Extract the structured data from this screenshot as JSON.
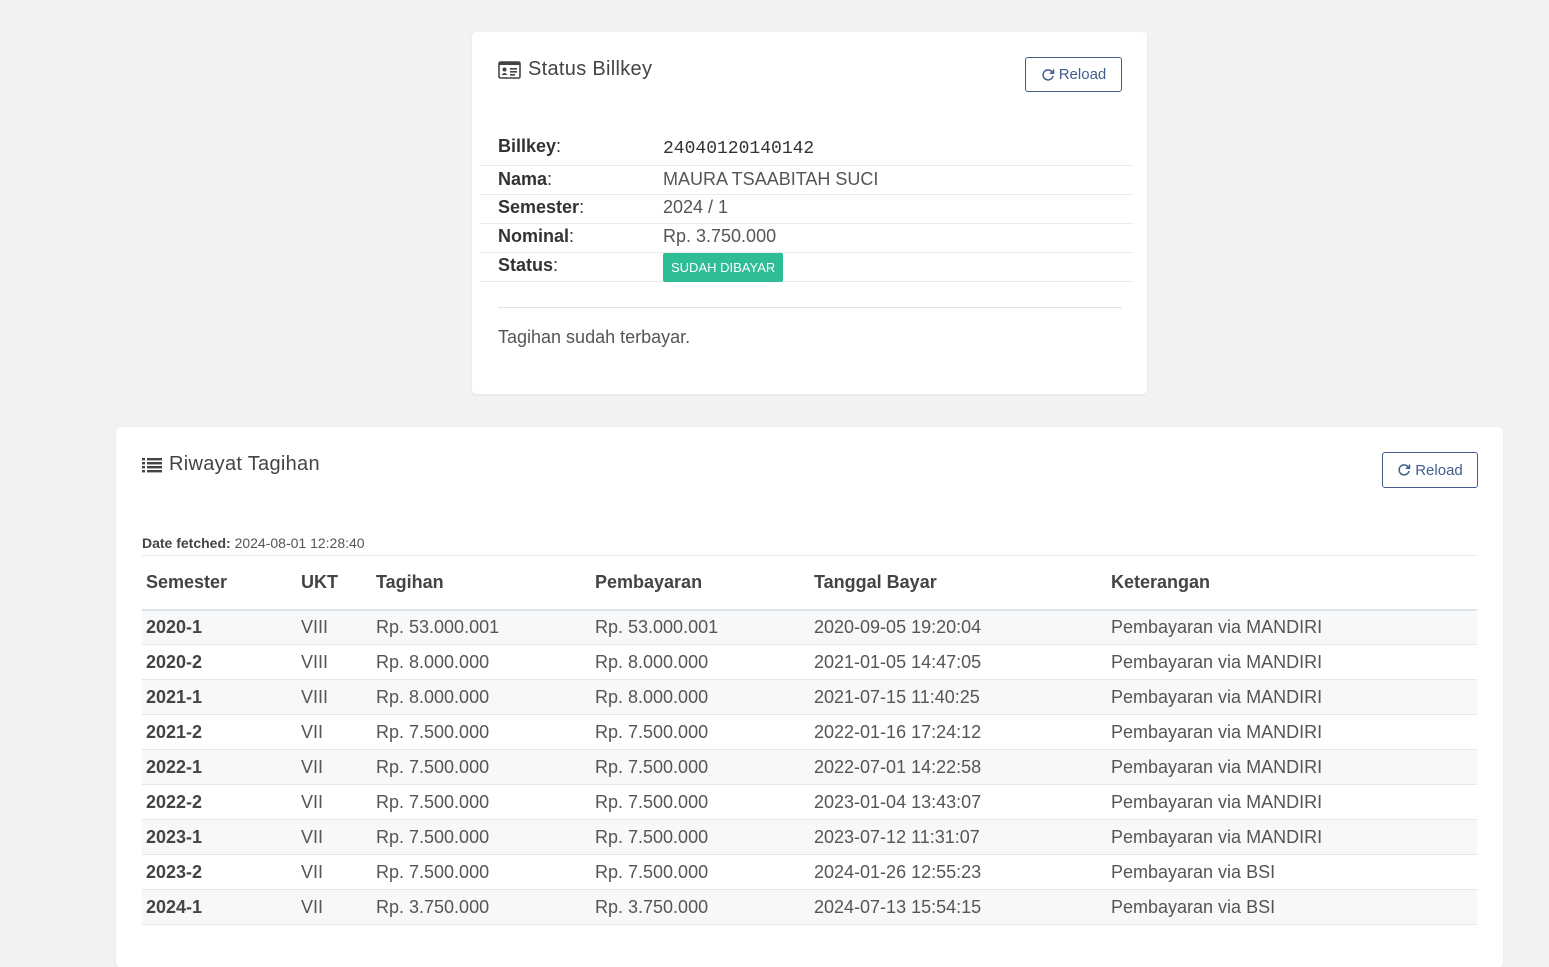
{
  "status_card": {
    "title": "Status Billkey",
    "reload_label": "Reload",
    "fields": {
      "billkey_label": "Billkey",
      "billkey_value": "24040120140142",
      "nama_label": "Nama",
      "nama_value": "MAURA TSAABITAH SUCI",
      "semester_label": "Semester",
      "semester_value": "2024 / 1",
      "nominal_label": "Nominal",
      "nominal_value": "Rp. 3.750.000",
      "status_label": "Status",
      "status_value": "SUDAH DIBAYAR"
    },
    "colon": ":",
    "note": "Tagihan sudah terbayar."
  },
  "history_card": {
    "title": "Riwayat Tagihan",
    "reload_label": "Reload",
    "fetched_label": "Date fetched:",
    "fetched_value": "2024-08-01 12:28:40",
    "columns": [
      "Semester",
      "UKT",
      "Tagihan",
      "Pembayaran",
      "Tanggal Bayar",
      "Keterangan"
    ],
    "rows": [
      [
        "2020-1",
        "VIII",
        "Rp. 53.000.001",
        "Rp. 53.000.001",
        "2020-09-05 19:20:04",
        "Pembayaran via MANDIRI"
      ],
      [
        "2020-2",
        "VIII",
        "Rp. 8.000.000",
        "Rp. 8.000.000",
        "2021-01-05 14:47:05",
        "Pembayaran via MANDIRI"
      ],
      [
        "2021-1",
        "VIII",
        "Rp. 8.000.000",
        "Rp. 8.000.000",
        "2021-07-15 11:40:25",
        "Pembayaran via MANDIRI"
      ],
      [
        "2021-2",
        "VII",
        "Rp. 7.500.000",
        "Rp. 7.500.000",
        "2022-01-16 17:24:12",
        "Pembayaran via MANDIRI"
      ],
      [
        "2022-1",
        "VII",
        "Rp. 7.500.000",
        "Rp. 7.500.000",
        "2022-07-01 14:22:58",
        "Pembayaran via MANDIRI"
      ],
      [
        "2022-2",
        "VII",
        "Rp. 7.500.000",
        "Rp. 7.500.000",
        "2023-01-04 13:43:07",
        "Pembayaran via MANDIRI"
      ],
      [
        "2023-1",
        "VII",
        "Rp. 7.500.000",
        "Rp. 7.500.000",
        "2023-07-12 11:31:07",
        "Pembayaran via MANDIRI"
      ],
      [
        "2023-2",
        "VII",
        "Rp. 7.500.000",
        "Rp. 7.500.000",
        "2024-01-26 12:55:23",
        "Pembayaran via BSI"
      ],
      [
        "2024-1",
        "VII",
        "Rp. 3.750.000",
        "Rp. 3.750.000",
        "2024-07-13 15:54:15",
        "Pembayaran via BSI"
      ]
    ]
  },
  "colors": {
    "badge_success": "#2ebd96",
    "button_border": "#3f5e8c",
    "page_background": "#f2f2f2"
  },
  "icons": {
    "status_title_icon": "id-card-icon",
    "history_title_icon": "list-icon",
    "reload_icon": "refresh-icon"
  }
}
